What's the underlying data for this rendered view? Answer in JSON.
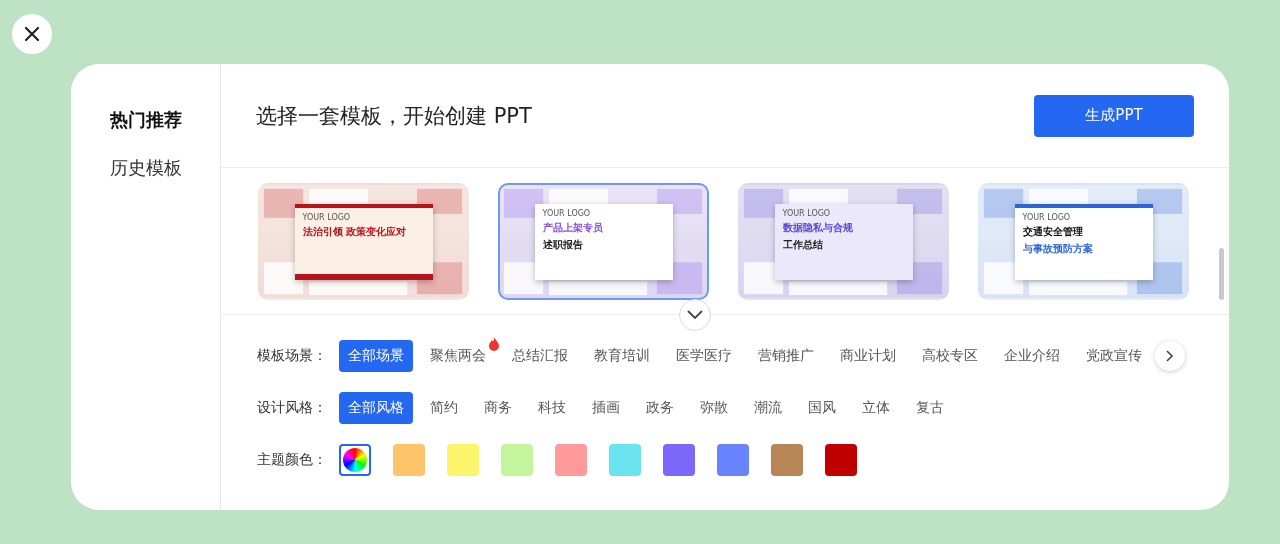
{
  "sidebar": {
    "items": [
      {
        "label": "热门推荐",
        "selected": true
      },
      {
        "label": "历史模板",
        "selected": false
      }
    ]
  },
  "header": {
    "title": "选择一套模板，开始创建 PPT",
    "button": "生成PPT"
  },
  "templates": [
    {
      "kind": "red",
      "logo": "YOUR LOGO",
      "title_1": "法治引领  政策变化应对",
      "selected": false
    },
    {
      "kind": "purple",
      "logo": "YOUR LOGO",
      "title_1": "产品上架专员",
      "title_2": "述职报告",
      "selected": true
    },
    {
      "kind": "violet",
      "logo": "YOUR LOGO",
      "title_1": "数据隐私与合规",
      "title_2": "工作总结",
      "selected": false
    },
    {
      "kind": "blue",
      "logo": "YOUR LOGO",
      "title_1": "交通安全管理",
      "title_2": "与事故预防方案",
      "selected": false
    }
  ],
  "filters": [
    {
      "label": "模板场景：",
      "options": [
        {
          "text": "全部场景",
          "selected": true,
          "hot": false
        },
        {
          "text": "聚焦两会",
          "selected": false,
          "hot": true
        },
        {
          "text": "总结汇报",
          "selected": false,
          "hot": false
        },
        {
          "text": "教育培训",
          "selected": false,
          "hot": false
        },
        {
          "text": "医学医疗",
          "selected": false,
          "hot": false
        },
        {
          "text": "营销推广",
          "selected": false,
          "hot": false
        },
        {
          "text": "商业计划",
          "selected": false,
          "hot": false
        },
        {
          "text": "高校专区",
          "selected": false,
          "hot": false
        },
        {
          "text": "企业介绍",
          "selected": false,
          "hot": false
        },
        {
          "text": "党政宣传",
          "selected": false,
          "hot": false
        }
      ],
      "more": true
    },
    {
      "label": "设计风格：",
      "options": [
        {
          "text": "全部风格",
          "selected": true,
          "hot": false
        },
        {
          "text": "简约",
          "selected": false,
          "hot": false
        },
        {
          "text": "商务",
          "selected": false,
          "hot": false
        },
        {
          "text": "科技",
          "selected": false,
          "hot": false
        },
        {
          "text": "插画",
          "selected": false,
          "hot": false
        },
        {
          "text": "政务",
          "selected": false,
          "hot": false
        },
        {
          "text": "弥散",
          "selected": false,
          "hot": false
        },
        {
          "text": "潮流",
          "selected": false,
          "hot": false
        },
        {
          "text": "国风",
          "selected": false,
          "hot": false
        },
        {
          "text": "立体",
          "selected": false,
          "hot": false
        },
        {
          "text": "复古",
          "selected": false,
          "hot": false
        }
      ]
    }
  ],
  "colors": {
    "label": "主题颜色：",
    "swatches": [
      {
        "kind": "rainbow",
        "selected": true
      },
      {
        "kind": "solid",
        "color": "#fdc46a",
        "selected": false
      },
      {
        "kind": "solid",
        "color": "#fcf56c",
        "selected": false
      },
      {
        "kind": "solid",
        "color": "#c4f59c",
        "selected": false
      },
      {
        "kind": "solid",
        "color": "#fe9a9a",
        "selected": false
      },
      {
        "kind": "solid",
        "color": "#6ae3ee",
        "selected": false
      },
      {
        "kind": "solid",
        "color": "#7b68fb",
        "selected": false
      },
      {
        "kind": "solid",
        "color": "#6884fc",
        "selected": false
      },
      {
        "kind": "solid",
        "color": "#b88656",
        "selected": false
      },
      {
        "kind": "solid",
        "color": "#c00000",
        "selected": false
      }
    ]
  }
}
